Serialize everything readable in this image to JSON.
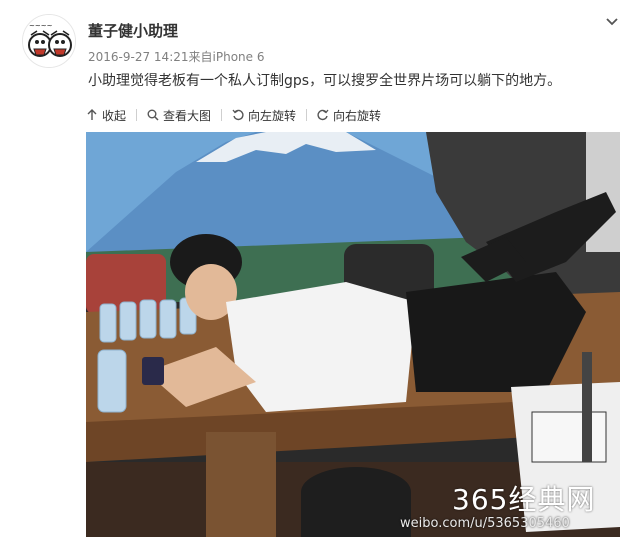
{
  "post": {
    "username": "董子健小助理",
    "date": "2016-9-27 14:21",
    "source_prefix": "来自",
    "source": "iPhone 6",
    "text": "小助理觉得老板有一个私人订制gps，可以搜罗全世界片场可以躺下的地方。"
  },
  "toolbar": {
    "collapse": "收起",
    "view_large": "查看大图",
    "rotate_left": "向左旋转",
    "rotate_right": "向右旋转"
  },
  "photo": {
    "watermark_logo": "365经典网",
    "watermark_url": "weibo.com/u/5365305460"
  },
  "colors": {
    "text": "#333333",
    "meta": "#808080",
    "sky": "#6fa6d6"
  }
}
